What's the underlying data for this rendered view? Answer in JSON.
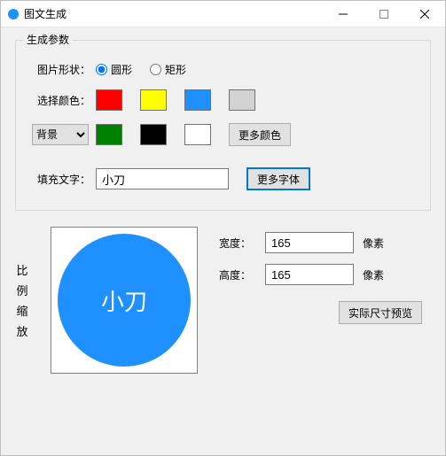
{
  "window": {
    "title": "图文生成"
  },
  "group": {
    "legend": "生成参数",
    "shape_label": "图片形状：",
    "shape_circle": "圆形",
    "shape_rect": "矩形",
    "color_label": "选择颜色：",
    "bg_label": "背景",
    "more_colors": "更多颜色",
    "text_label": "填充文字：",
    "text_value": "小刀",
    "more_fonts": "更多字体"
  },
  "scale": {
    "c1": "比",
    "c2": "例",
    "c3": "缩",
    "c4": "放"
  },
  "dims": {
    "width_label": "宽度：",
    "width_value": "165",
    "height_label": "高度：",
    "height_value": "165",
    "unit": "像素",
    "preview_btn": "实际尺寸预览"
  },
  "preview": {
    "circle_text": "小刀"
  }
}
